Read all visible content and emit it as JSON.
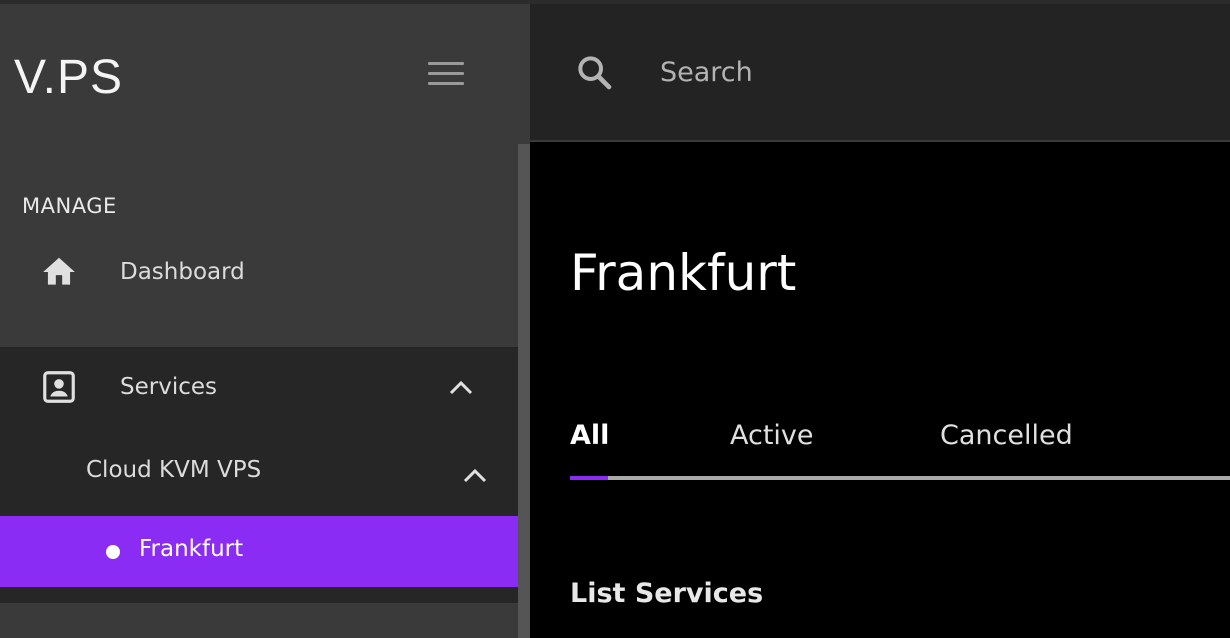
{
  "brand": {
    "logo_text": "V.PS"
  },
  "search": {
    "placeholder": "Search"
  },
  "sidebar": {
    "section_label": "MANAGE",
    "items": [
      {
        "label": "Dashboard",
        "icon": "home-icon"
      },
      {
        "label": "Services",
        "icon": "contact-card-icon",
        "expanded": true
      }
    ],
    "submenu": {
      "group_label": "Cloud KVM VPS",
      "active_item": "Frankfurt"
    }
  },
  "main": {
    "title": "Frankfurt",
    "tabs": [
      {
        "label": "All",
        "active": true
      },
      {
        "label": "Active",
        "active": false
      },
      {
        "label": "Cancelled",
        "active": false
      }
    ],
    "section_heading": "List Services"
  },
  "colors": {
    "accent": "#8b2cf5",
    "sidebar_bg": "#3a3a3a",
    "header_bg": "#232323",
    "main_bg": "#000000"
  }
}
